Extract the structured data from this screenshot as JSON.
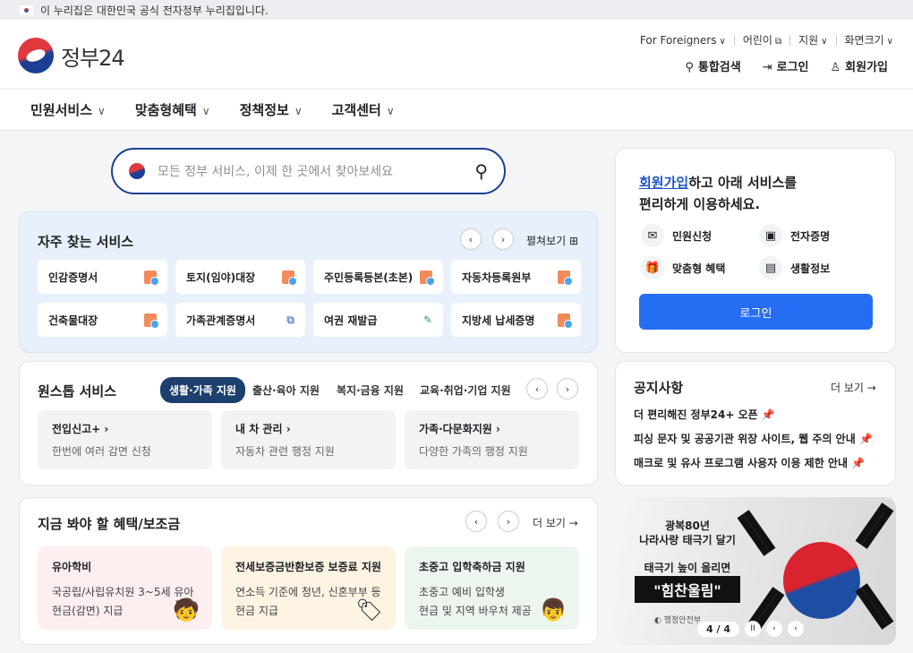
{
  "gov_banner": {
    "text": "이 누리집은 대한민국 공식 전자정부 누리집입니다."
  },
  "logo": {
    "text": "정부24"
  },
  "top_links": {
    "foreigners": "For Foreigners",
    "kids": "어린이",
    "support": "지원",
    "font_size": "화면크기"
  },
  "user_links": {
    "search": "통합검색",
    "login": "로그인",
    "signup": "회원가입"
  },
  "nav": {
    "items": [
      "민원서비스",
      "맞춤형혜택",
      "정책정보",
      "고객센터"
    ]
  },
  "search": {
    "placeholder": "모든 정부 서비스, 이제 한 곳에서 찾아보세요"
  },
  "frequent": {
    "title": "자주 찾는 서비스",
    "expand": "펼쳐보기",
    "items": [
      "인감증명서",
      "토지(임야)대장",
      "주민등록등본(초본)",
      "자동차등록원부",
      "건축물대장",
      "가족관계증명서",
      "여권 재발급",
      "지방세 납세증명"
    ]
  },
  "onestop": {
    "title": "원스톱 서비스",
    "tabs": [
      "생활·가족 지원",
      "출산·육아 지원",
      "복지·금융 지원",
      "교육·취업·기업 지원"
    ],
    "boxes": [
      {
        "title": "전입신고+",
        "desc": "한번에 여러 감면 신청"
      },
      {
        "title": "내 차 관리",
        "desc": "자동차 관련 행정 지원"
      },
      {
        "title": "가족·다문화지원",
        "desc": "다양한 가족의 행정 지원"
      }
    ]
  },
  "benefits": {
    "title": "지금 봐야 할 혜택/보조금",
    "more": "더 보기",
    "boxes": [
      {
        "title": "유아학비",
        "line1": "국공립/사립유치원 3~5세 유아",
        "line2": "현금(감면) 지급",
        "color": "#fdeef0"
      },
      {
        "title": "전세보증금반환보증 보증료 지원",
        "line1": "연소득 기준에 청년, 신혼부부 등",
        "line2": "현금 지급",
        "color": "#fdf3e3"
      },
      {
        "title": "초중고 입학축하금 지원",
        "line1": "초중고 예비 입학생",
        "line2": "현금 및 지역 바우처 제공",
        "color": "#edf6ee"
      }
    ]
  },
  "member": {
    "link": "회원가입",
    "msg1": "하고 아래 서비스를",
    "msg2": "편리하게 이용하세요.",
    "services": [
      "민원신청",
      "전자증명",
      "맞춤형 혜택",
      "생활정보"
    ],
    "login_button": "로그인"
  },
  "notice": {
    "title": "공지사항",
    "more": "더 보기",
    "items": [
      "더 편리해진 정부24+ 오픈",
      "피싱 문자 및 공공기관 위장 사이트, 웹 주의 안내",
      "매크로 및 유사 프로그램 사용자 이용 제한 안내"
    ]
  },
  "banner": {
    "line1": "광복80년",
    "line2": "나라사랑 태극기 달기",
    "line3": "태극기 높이 올리면",
    "line4": "\"힘찬울림\"",
    "org": "행정안전부",
    "pager": "4 / 4"
  }
}
